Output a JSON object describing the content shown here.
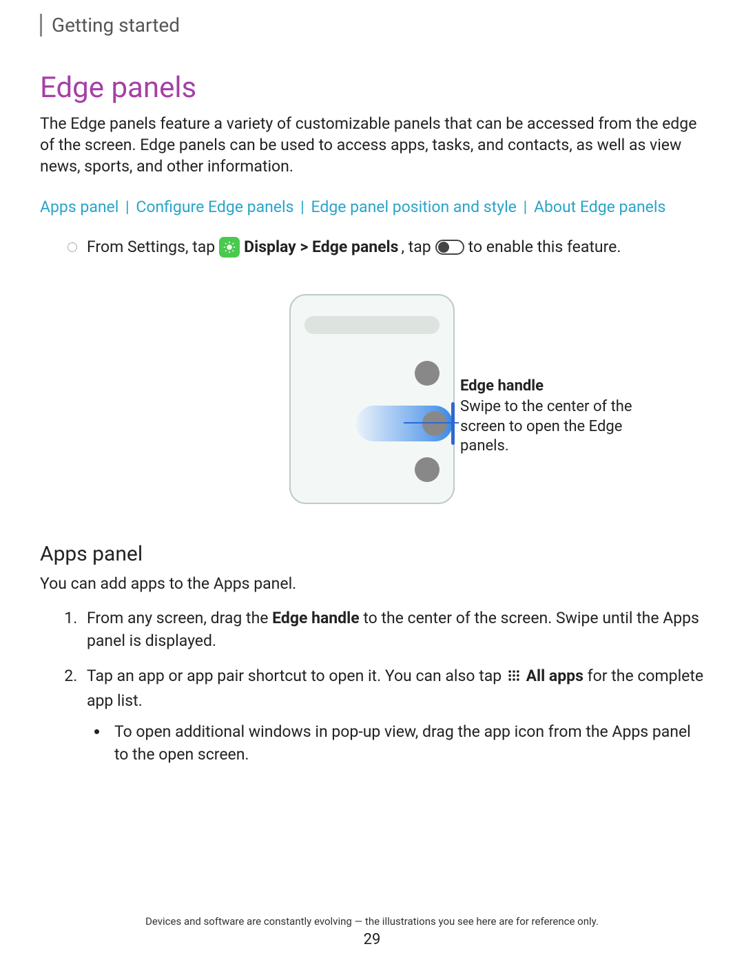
{
  "breadcrumb": "Getting started",
  "title": "Edge panels",
  "intro": "The Edge panels feature a variety of customizable panels that can be accessed from the edge of the screen. Edge panels can be used to access apps, tasks, and contacts, as well as view news, sports, and other information.",
  "links": {
    "apps_panel": "Apps panel",
    "configure": "Configure Edge panels",
    "position": "Edge panel position and style",
    "about": "About Edge panels",
    "sep": "|"
  },
  "step": {
    "pre": "From Settings, tap",
    "path": "Display > Edge panels",
    "mid": ", tap",
    "post": "to enable this feature."
  },
  "callout": {
    "title": "Edge handle",
    "desc": "Swipe to the center of the screen to open the Edge panels."
  },
  "apps_panel": {
    "heading": "Apps panel",
    "intro": "You can add apps to the Apps panel.",
    "step1_a": "From any screen, drag the ",
    "step1_b": "Edge handle",
    "step1_c": " to the center of the screen. Swipe until the Apps panel is displayed.",
    "step2_a": "Tap an app or app pair shortcut to open it. You can also tap",
    "step2_b": "All apps",
    "step2_c": " for the complete app list.",
    "sub_a": "To open additional windows in pop-up view, drag the app icon from the Apps panel to the open screen."
  },
  "footer": "Devices and software are constantly evolving — the illustrations you see here are for reference only.",
  "page_number": "29"
}
